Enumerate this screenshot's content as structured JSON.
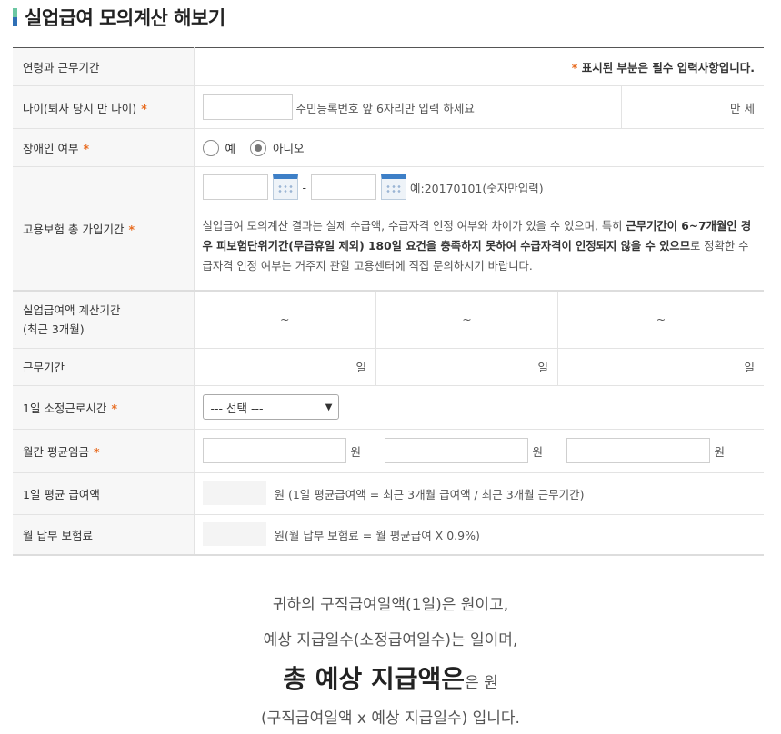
{
  "title": "실업급여 모의계산 해보기",
  "header_row": {
    "label": "연령과 근무기간",
    "note_star": "*",
    "note": "표시된 부분은 필수 입력사항입니다."
  },
  "age": {
    "label": "나이(퇴사 당시 만 나이)",
    "hint": "주민등록번호 앞 6자리만 입력 하세요",
    "result_label": "만 세"
  },
  "disability": {
    "label": "장애인 여부",
    "yes": "예",
    "no": "아니오"
  },
  "insurance": {
    "label": "고용보험 총 가입기간",
    "dash": "-",
    "example": "예:20170101(숫자만입력)",
    "para_1": "실업급여 모의계산 결과는 실제 수급액, 수급자격 인정 여부와 차이가 있을 수 있으며, 특히 ",
    "para_bold": "근무기간이 6~7개월인 경우 피보험단위기간(무급휴일 제외) 180일 요건을 충족하지 못하여 수급자격이 인정되지 않을 수 있으므",
    "para_2": "로 정확한 수급자격 인정 여부는 거주지 관할 고용센터에 직접 문의하시기 바랍니다."
  },
  "calc_period": {
    "label_1": "실업급여액 계산기간",
    "label_2": "(최근 3개월)",
    "cols": [
      "~",
      "~",
      "~"
    ]
  },
  "work_days": {
    "label": "근무기간",
    "cols": [
      "일",
      "일",
      "일"
    ]
  },
  "daily_hours": {
    "label": "1일 소정근로시간",
    "select_value": "--- 선택 ---"
  },
  "monthly_wage": {
    "label": "월간 평균임금",
    "unit": "원"
  },
  "daily_avg": {
    "label": "1일 평균 급여액",
    "text": "원 (1일 평균급여액 = 최근 3개월 급여액 / 최근 3개월 근무기간)"
  },
  "premium": {
    "label": "월 납부 보험료",
    "text": "원(월 납부 보험료 = 월 평균급여 X 0.9%)"
  },
  "result": {
    "line1": "귀하의 구직급여일액(1일)은 원이고,",
    "line2": "예상 지급일수(소정급여일수)는 일이며,",
    "line3_bold": "총 예상 지급액은",
    "line3_rest": "은 원",
    "line4": "(구직급여일액 x 예상 지급일수) 입니다."
  }
}
